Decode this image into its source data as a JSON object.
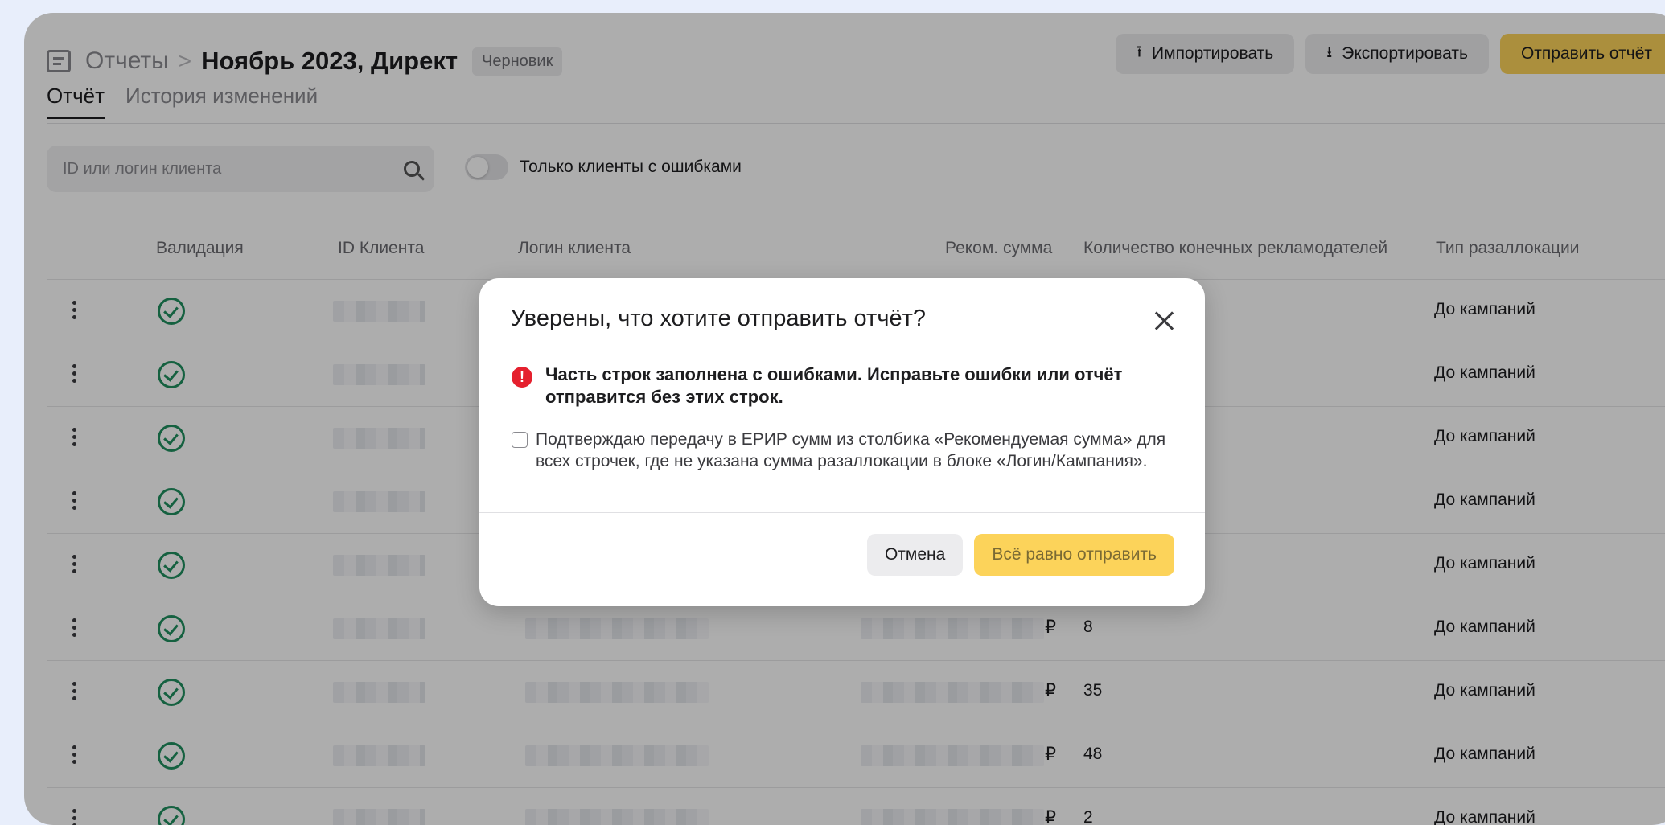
{
  "header": {
    "crumb_root": "Отчеты",
    "crumb_separator": ">",
    "crumb_current": "Ноябрь 2023, Директ",
    "status_badge": "Черновик",
    "import_label": "Импортировать",
    "export_label": "Экспортировать",
    "send_label": "Отправить отчёт"
  },
  "tabs": [
    {
      "label": "Отчёт",
      "active": true
    },
    {
      "label": "История изменений",
      "active": false
    }
  ],
  "filters": {
    "search_placeholder": "ID или логин клиента",
    "toggle_label": "Только клиенты с ошибками"
  },
  "table": {
    "columns": [
      "Валидация",
      "ID Клиента",
      "Логин клиента",
      "Реком. сумма",
      "Количество конечных рекламодателей",
      "Тип разаллокации"
    ],
    "rows": [
      {
        "count": "",
        "type": "До кампаний"
      },
      {
        "count": "",
        "type": "До кампаний"
      },
      {
        "count": "",
        "type": "До кампаний"
      },
      {
        "count": "",
        "type": "До кампаний"
      },
      {
        "count": "",
        "type": "До кампаний"
      },
      {
        "count": "8",
        "type": "До кампаний"
      },
      {
        "count": "35",
        "type": "До кампаний"
      },
      {
        "count": "48",
        "type": "До кампаний"
      },
      {
        "count": "2",
        "type": "До кампаний"
      }
    ],
    "currency_symbol": "₽"
  },
  "modal": {
    "title": "Уверены, что хотите отправить отчёт?",
    "error_icon": "!",
    "error_text": "Часть строк заполнена с ошибками. Исправьте ошибки или отчёт отправится без этих строк.",
    "checkbox_text": "Подтверждаю передачу в ЕРИР сумм из столбика «Рекомендуемая сумма» для всех строчек, где не указана сумма разаллокации в блоке «Логин/Кампания».",
    "cancel_label": "Отмена",
    "confirm_label": "Всё равно отправить"
  }
}
